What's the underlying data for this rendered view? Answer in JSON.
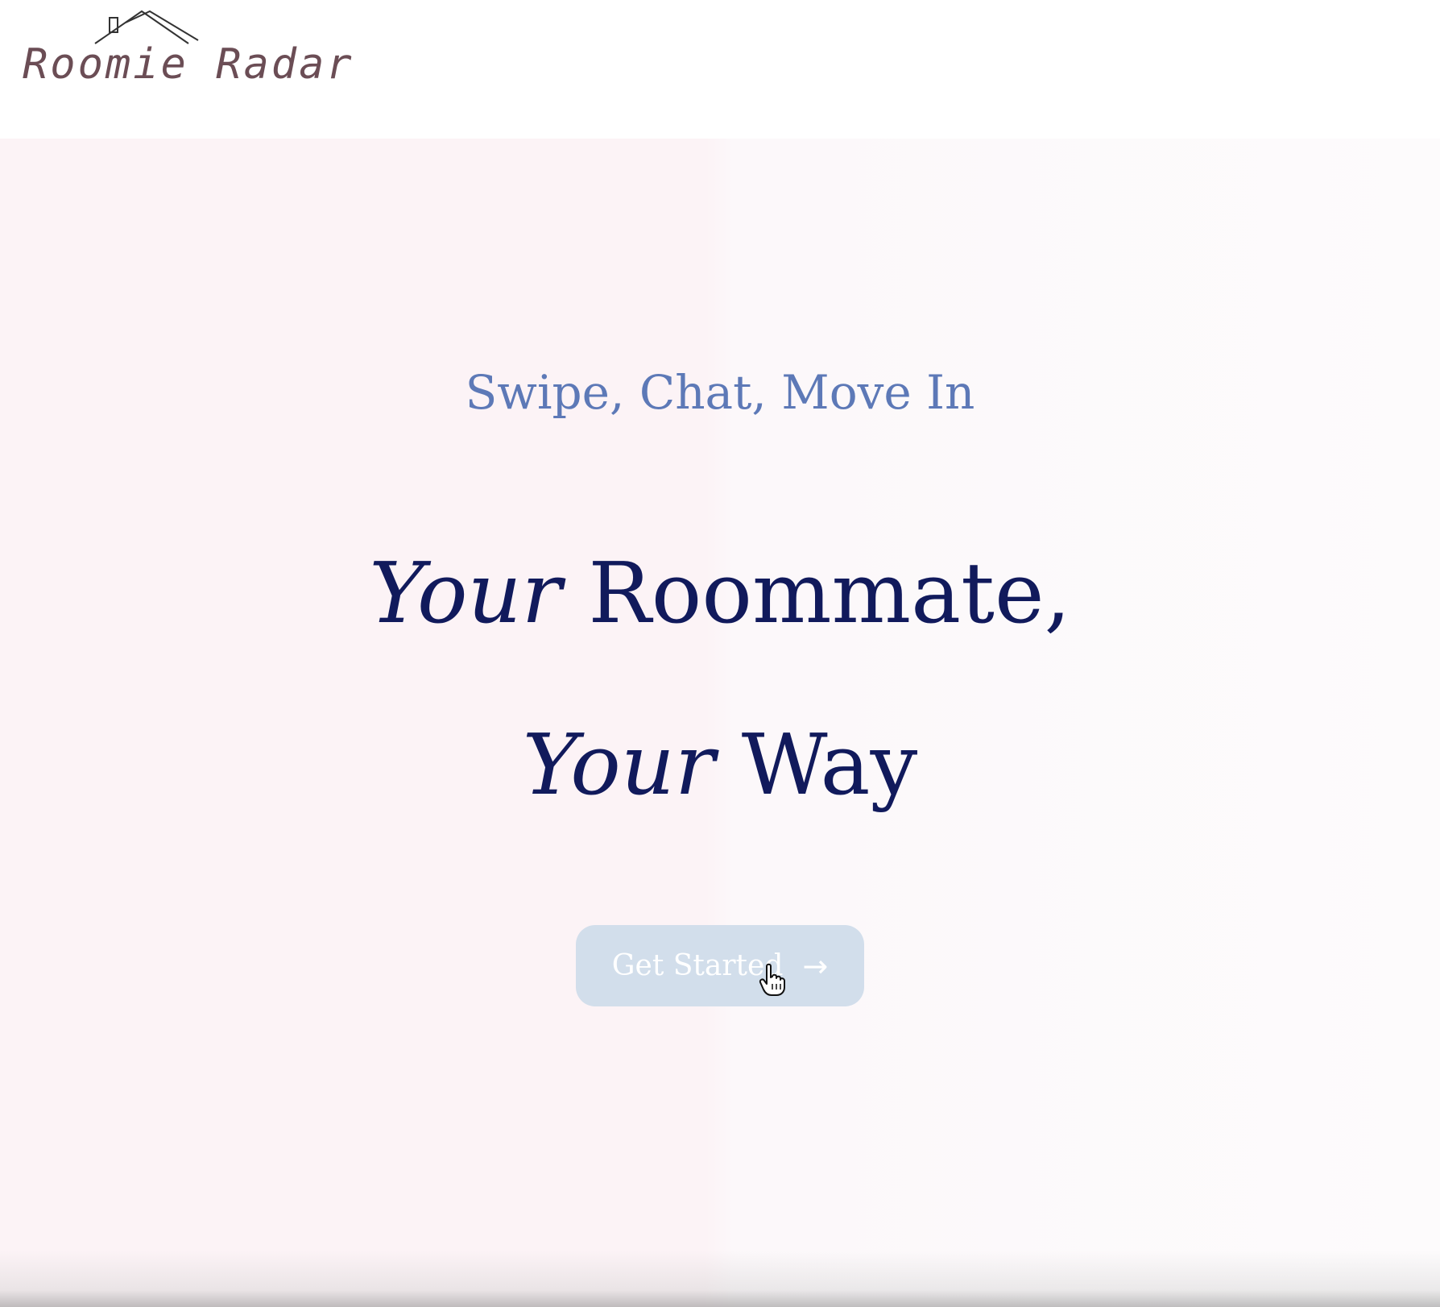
{
  "header": {
    "logo_text": "Roomie Radar",
    "logo_icon": "house-roof-icon"
  },
  "hero": {
    "tagline": "Swipe, Chat, Move In",
    "headline": {
      "line1_italic": "Your",
      "line1_regular": "Roommate,",
      "line2_italic": "Your",
      "line2_regular": "Way"
    },
    "cta_label": "Get Started",
    "cta_arrow": "→"
  },
  "colors": {
    "tagline": "#5d79b7",
    "headline": "#111a5c",
    "cta_bg": "#d2deeb",
    "logo": "#6b4d55",
    "hero_left_bg": "#fcf3f6",
    "hero_right_bg": "#fdfbfc"
  },
  "icons": {
    "cursor": "hand-pointer-icon"
  }
}
